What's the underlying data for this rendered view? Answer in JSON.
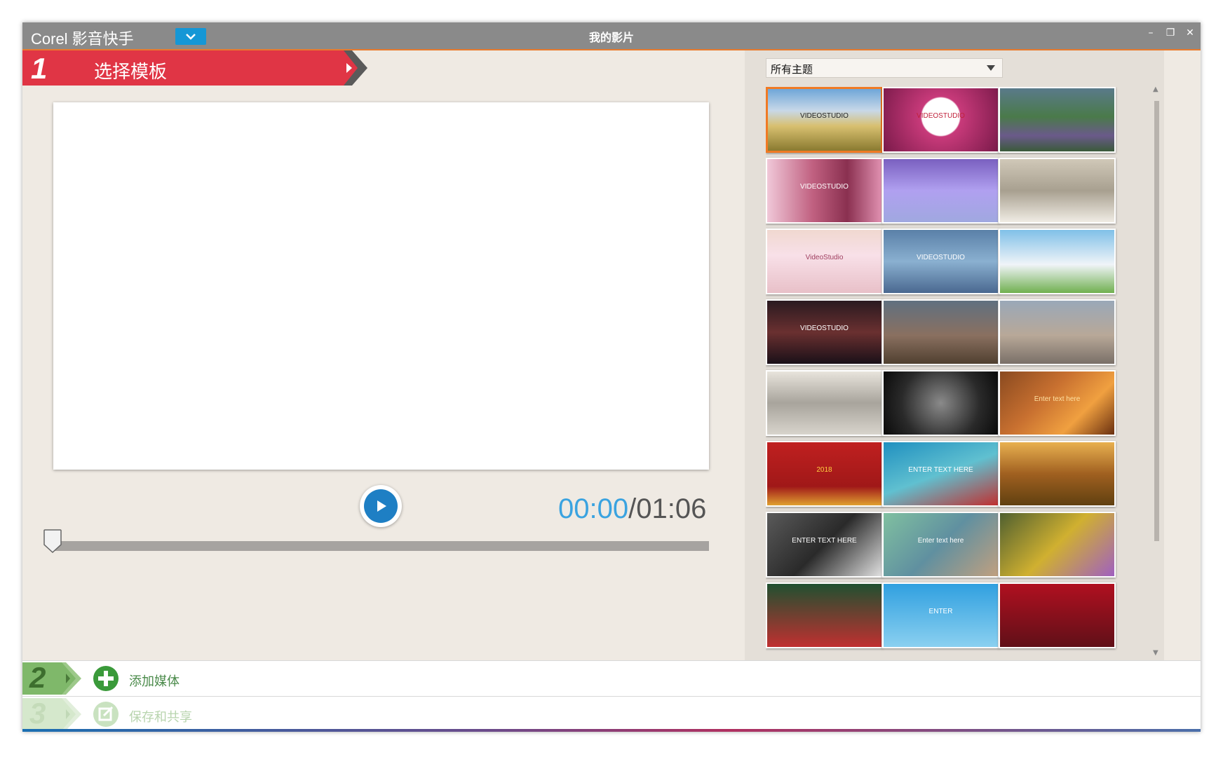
{
  "titlebar": {
    "app_name": "Corel 影音快手",
    "window_title": "我的影片",
    "minimize": "–",
    "restore": "❐",
    "close": "✕"
  },
  "step1": {
    "number": "1",
    "label": "选择模板"
  },
  "player": {
    "current_time": "00:00",
    "separator": "/",
    "total_time": "01:06",
    "progress": 0
  },
  "template_panel": {
    "filter_selected": "所有主题",
    "templates": [
      {
        "id": 1,
        "text": "VIDEOSTUDIO",
        "selected": true
      },
      {
        "id": 2,
        "text": "VIDEOSTUDIO",
        "selected": false
      },
      {
        "id": 3,
        "text": "",
        "selected": false
      },
      {
        "id": 4,
        "text": "VIDEOSTUDIO",
        "selected": false
      },
      {
        "id": 5,
        "text": "",
        "selected": false
      },
      {
        "id": 6,
        "text": "",
        "selected": false
      },
      {
        "id": 7,
        "text": "VideoStudio",
        "selected": false
      },
      {
        "id": 8,
        "text": "VIDEOSTUDIO",
        "selected": false
      },
      {
        "id": 9,
        "text": "",
        "selected": false
      },
      {
        "id": 10,
        "text": "VIDEOSTUDIO",
        "selected": false
      },
      {
        "id": 11,
        "text": "",
        "selected": false
      },
      {
        "id": 12,
        "text": "",
        "selected": false
      },
      {
        "id": 13,
        "text": "",
        "selected": false
      },
      {
        "id": 14,
        "text": "",
        "selected": false
      },
      {
        "id": 15,
        "text": "Enter text here",
        "selected": false
      },
      {
        "id": 16,
        "text": "2018",
        "selected": false
      },
      {
        "id": 17,
        "text": "ENTER TEXT HERE",
        "selected": false
      },
      {
        "id": 18,
        "text": "",
        "selected": false
      },
      {
        "id": 19,
        "text": "ENTER TEXT HERE",
        "selected": false
      },
      {
        "id": 20,
        "text": "Enter text here",
        "selected": false
      },
      {
        "id": 21,
        "text": "",
        "selected": false
      },
      {
        "id": 22,
        "text": "",
        "selected": false
      },
      {
        "id": 23,
        "text": "ENTER",
        "selected": false
      },
      {
        "id": 24,
        "text": "",
        "selected": false
      }
    ]
  },
  "steps": [
    {
      "number": "2",
      "label": "添加媒体",
      "enabled": true
    },
    {
      "number": "3",
      "label": "保存和共享",
      "enabled": false
    }
  ],
  "colors": {
    "accent_red": "#e03545",
    "accent_blue": "#1597d6",
    "time_blue": "#3aa3e0",
    "step_green": "#3a9a3a",
    "selected_border": "#f07a24"
  }
}
